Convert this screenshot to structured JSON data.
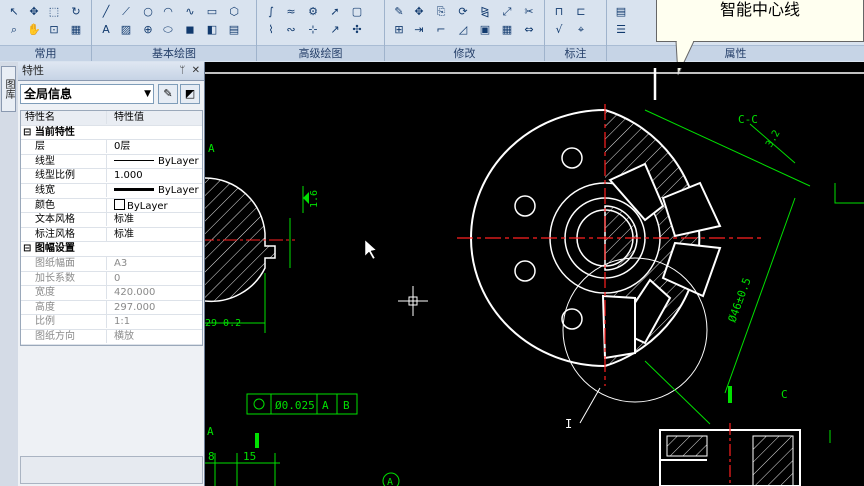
{
  "ribbon": {
    "groups": [
      {
        "id": "common",
        "label": "常用"
      },
      {
        "id": "basic-draw",
        "label": "基本绘图"
      },
      {
        "id": "advanced-draw",
        "label": "高级绘图"
      },
      {
        "id": "modify",
        "label": "修改"
      },
      {
        "id": "annotate",
        "label": "标注"
      },
      {
        "id": "properties",
        "label": "属性"
      }
    ]
  },
  "callout": {
    "text": "智能中心线"
  },
  "left_strip": {
    "tab": "图库"
  },
  "properties_panel": {
    "title": "特性",
    "select_value": "全局信息",
    "headers": {
      "name": "特性名",
      "value": "特性值"
    },
    "sections": [
      {
        "title": "当前特性",
        "rows": [
          {
            "name": "层",
            "value": "0层"
          },
          {
            "name": "线型",
            "value": "ByLayer"
          },
          {
            "name": "线型比例",
            "value": "1.000"
          },
          {
            "name": "线宽",
            "value": "ByLayer"
          },
          {
            "name": "颜色",
            "value": "ByLayer"
          },
          {
            "name": "文本风格",
            "value": "标准"
          },
          {
            "name": "标注风格",
            "value": "标准"
          }
        ]
      },
      {
        "title": "图幅设置",
        "rows": [
          {
            "name": "图纸幅面",
            "value": "A3"
          },
          {
            "name": "加长系数",
            "value": "0"
          },
          {
            "name": "宽度",
            "value": "420.000"
          },
          {
            "name": "高度",
            "value": "297.000"
          },
          {
            "name": "比例",
            "value": "1:1"
          },
          {
            "name": "图纸方向",
            "value": "横放"
          }
        ]
      }
    ]
  },
  "drawing": {
    "labels": {
      "section_cc": "C-C",
      "tol_value": "Ø0.025",
      "datum_a": "A",
      "datum_b": "B",
      "dim_32": "3.2",
      "dim_16": "1.6",
      "dim_15": "15",
      "dim_8": "8",
      "dim_dia": "Ø46±0.5",
      "dim_left": "29-0.2",
      "view_c": "C",
      "label_i": "I",
      "label_a_left": "A",
      "label_a_top": "A",
      "circle_a": "A"
    },
    "colors": {
      "background": "#000000",
      "outline": "#ffffff",
      "center": "#ff2020",
      "dimension": "#00e000",
      "hatch": "#ffffff"
    }
  }
}
